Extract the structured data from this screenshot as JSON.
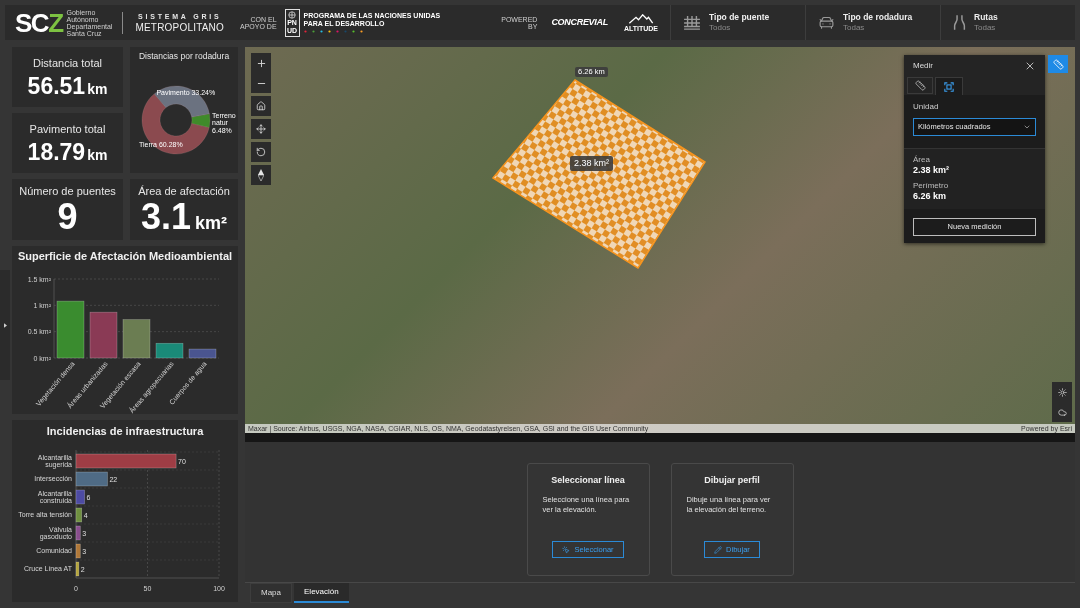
{
  "header": {
    "logo": {
      "mark": "SC",
      "accent": "Z",
      "subtitle": [
        "Gobierno",
        "Autónomo",
        "Departamental",
        "Santa Cruz"
      ]
    },
    "app_title": {
      "top": "SISTEMA GRIS",
      "bottom": "METROPOLITANO"
    },
    "support_label": [
      "CON EL",
      "APOYO DE"
    ],
    "agency": {
      "letters": [
        "PN",
        "UD"
      ],
      "name": [
        "PROGRAMA DE LAS NACIONES UNIDAS",
        "PARA EL DESARROLLO"
      ]
    },
    "powered_label": [
      "POWERED",
      "BY"
    ],
    "partners": [
      {
        "kind": "wordmark",
        "name": "CONCREVIAL"
      },
      {
        "kind": "mountain",
        "name": "ALTITUDE"
      }
    ],
    "filters": [
      {
        "kind": "bridge",
        "title": "Tipo de puente",
        "value": "Todos"
      },
      {
        "kind": "vehicle",
        "title": "Tipo de rodadura",
        "value": "Todas"
      },
      {
        "kind": "routes",
        "title": "Rutas",
        "value": "Todas"
      }
    ]
  },
  "indicators": [
    {
      "label": "Distancia total",
      "value": "56.51",
      "unit": "km"
    },
    {
      "label": "Pavimento total",
      "value": "18.79",
      "unit": "km"
    },
    {
      "label": "Número de puentes",
      "value": "9"
    },
    {
      "label": "Área de afectación",
      "value": "3.1",
      "unit": "km²"
    }
  ],
  "distance_chart": {
    "chart_data": {
      "type": "donut",
      "title": "Distancias por rodadura",
      "categories": [
        "Pavimento",
        "Terreno natur",
        "Tierra"
      ],
      "values": [
        33.24,
        6.48,
        60.28
      ],
      "colors": [
        "#6b7280",
        "#3f8a2a",
        "#8b4a4f"
      ],
      "value_labels": [
        "33.24%",
        "6.48%",
        "60.28%"
      ]
    }
  },
  "environment_chart": {
    "chart_data": {
      "type": "bar",
      "title": "Superficie de Afectación Medioambiental",
      "categories": [
        "Vegetación densa",
        "Áreas urbanizadas",
        "Vegetación escasa",
        "Áreas agropecuarias",
        "Cuerpos de agua"
      ],
      "values": [
        1.08,
        0.87,
        0.73,
        0.28,
        0.17
      ],
      "colors": [
        "#3a8c2f",
        "#8a3a55",
        "#6b7d52",
        "#1a8a78",
        "#4a5590"
      ],
      "ylim": [
        0,
        1.5
      ],
      "yticks": [
        {
          "value": 0,
          "label": "0 km²"
        },
        {
          "value": 0.5,
          "label": "0.5 km²"
        },
        {
          "value": 1,
          "label": "1 km²"
        },
        {
          "value": 1.5,
          "label": "1.5 km²"
        }
      ],
      "grid": true
    }
  },
  "infrastructure_chart": {
    "chart_data": {
      "type": "bar",
      "orientation": "horizontal",
      "title": "Incidencias de infraestructura",
      "categories": [
        "Alcantarilla sugerida",
        "Intersección",
        "Alcantarilla construida",
        "Torre alta tensión",
        "Válvula gasoducto",
        "Comunidad",
        "Cruce Línea AT"
      ],
      "values": [
        70,
        22,
        6,
        4,
        3,
        3,
        2
      ],
      "colors": [
        "#9e3d45",
        "#4f6b85",
        "#4d4ba3",
        "#6f9040",
        "#8a4e8e",
        "#b07838",
        "#b5a53a"
      ],
      "xlim": [
        0,
        100
      ],
      "xticks": [
        0,
        50,
        100
      ],
      "ref_lines": [
        {
          "axis": "x",
          "value": 50
        },
        {
          "axis": "x",
          "value": 100
        }
      ],
      "grid": true,
      "data_labels": true
    }
  },
  "map": {
    "measure_tool_active": true,
    "overlay": {
      "area_label": "2.38 km²",
      "edge_label": "6.26 km"
    },
    "attribution": "Maxar | Source: Airbus, USGS, NGA, NASA, CGIAR, NLS, OS, NMA, Geodatastyrelsen, GSA, GSI and the GIS User Community",
    "powered_by": "Powered by Esri"
  },
  "measure_panel": {
    "title": "Medir",
    "tabs": [
      {
        "kind": "distance",
        "selected": false
      },
      {
        "kind": "area",
        "selected": true
      }
    ],
    "unit_label": "Unidad",
    "unit_value": "Kilómetros cuadrados",
    "results": [
      {
        "label": "Área",
        "value": "2.38 km²"
      },
      {
        "label": "Perímetro",
        "value": "6.26 km"
      }
    ],
    "button": "Nueva medición"
  },
  "elevation": {
    "cards": [
      {
        "kind": "select",
        "title": "Seleccionar línea",
        "text": "Seleccione una línea para ver la elevación.",
        "button": "Seleccionar"
      },
      {
        "kind": "draw",
        "title": "Dibujar perfil",
        "text": "Dibuje una línea para ver la elevación del terreno.",
        "button": "Dibujar"
      }
    ]
  },
  "view_tabs": [
    {
      "label": "Mapa",
      "selected": false
    },
    {
      "label": "Elevación",
      "selected": true
    }
  ]
}
